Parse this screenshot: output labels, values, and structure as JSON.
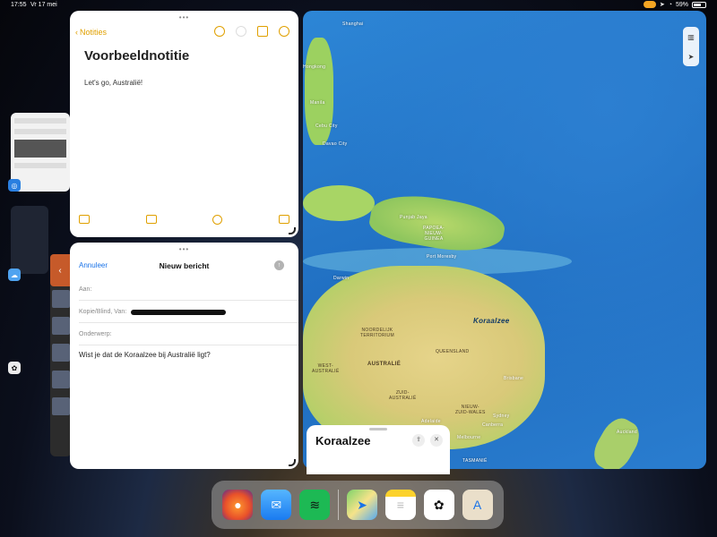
{
  "status": {
    "time": "17:55",
    "date": "Vr 17 mei",
    "battery": "59%",
    "battery_level": 0.59
  },
  "notes": {
    "back_label": "Notities",
    "title": "Voorbeeldnotitie",
    "body": "Let's go, Australië!"
  },
  "mail": {
    "cancel_label": "Annuleer",
    "title": "Nieuw bericht",
    "to_label": "Aan:",
    "cc_label": "Kopie/Blind, Van:",
    "subject_label": "Onderwerp:",
    "body": "Wist je dat de Koraalzee bij Australië ligt?"
  },
  "map": {
    "sheet_title": "Koraalzee",
    "labels": {
      "shanghai": "Shanghai",
      "manila": "Manila",
      "cebu": "Cebu City",
      "davao": "Davao City",
      "papua": "PAPOEA-\nNIEUW-\nGUINEA",
      "port_moresby": "Port Moresby",
      "darwin": "Darwin",
      "coral_sea": "Koraalzee",
      "northern_territory": "NOORDELIJK\nTERRITORIUM",
      "queensland": "QUEENSLAND",
      "western_australia": "WEST-\nAUSTRALIË",
      "australia": "AUSTRALIË",
      "south_australia": "ZUID-\nAUSTRALIË",
      "nsw": "NIEUW-\nZUID-WALES",
      "brisbane": "Brisbane",
      "sydney": "Sydney",
      "canberra": "Canberra",
      "melbourne": "Melbourne",
      "adelaide": "Adelaide",
      "tasmania": "TASMANIË",
      "auckland": "Auckland",
      "punjab": "Punjab Jaya",
      "hong_kong": "Hongkong"
    }
  },
  "dock": [
    "firefox",
    "mail",
    "spotify",
    "maps",
    "notes",
    "chatgpt",
    "app-store-library"
  ]
}
